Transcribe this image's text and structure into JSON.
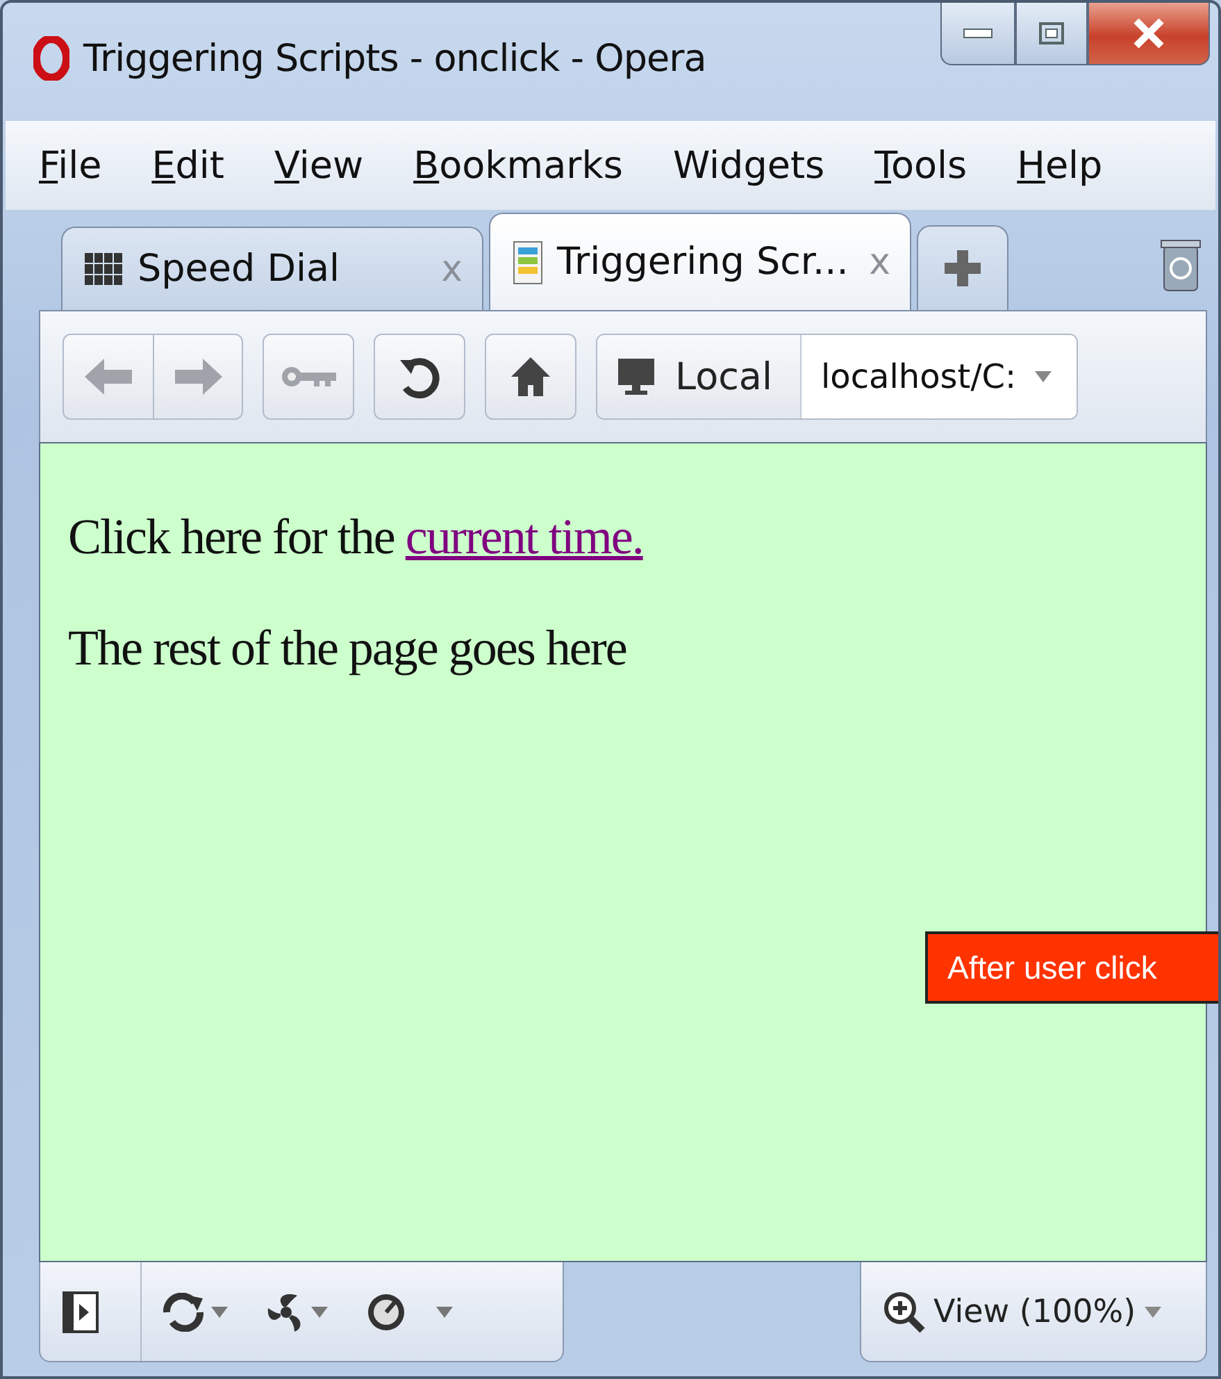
{
  "window": {
    "title": "Triggering Scripts - onclick - Opera"
  },
  "menu": [
    {
      "label": "File",
      "first_letter_underlined": true
    },
    {
      "label": "Edit",
      "first_letter_underlined": true
    },
    {
      "label": "View",
      "first_letter_underlined": true
    },
    {
      "label": "Bookmarks",
      "first_letter_underlined": true
    },
    {
      "label": "Widgets",
      "first_letter_underlined": false
    },
    {
      "label": "Tools",
      "first_letter_underlined": true
    },
    {
      "label": "Help",
      "first_letter_underlined": true
    }
  ],
  "tabs": [
    {
      "label": "Speed Dial",
      "kind": "speeddial",
      "selected": false,
      "close": "x"
    },
    {
      "label": "Triggering Scr...",
      "kind": "page",
      "selected": true,
      "close": "x"
    }
  ],
  "address": {
    "site_label": "Local",
    "value": "localhost/C:"
  },
  "content": {
    "lead": "Click here for the ",
    "link": "current time.",
    "paragraph": "The rest of the page goes here"
  },
  "callout": {
    "text": "After user click"
  },
  "status_bar": {
    "zoom": "View (100%)"
  }
}
